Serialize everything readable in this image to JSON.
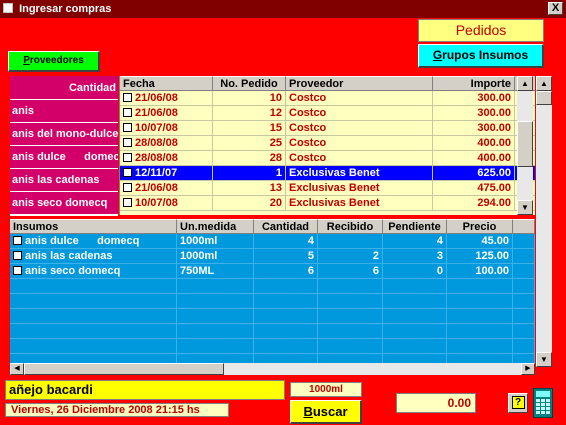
{
  "window": {
    "title": "Ingresar compras",
    "close_label": "X"
  },
  "buttons": {
    "pedidos": "Pedidos",
    "grupos_first": "G",
    "grupos_rest": "rupos Insumos",
    "proveedores_first": "P",
    "proveedores_rest": "roveedores",
    "buscar_first": "B",
    "buscar_rest": "uscar"
  },
  "left_list": {
    "header": "Cantidad",
    "items": [
      "anis",
      "anis del mono-dulce",
      "anis dulce      domec",
      "anis las cadenas",
      "anis seco domecq"
    ]
  },
  "orders": {
    "columns": [
      "Fecha",
      "No. Pedido",
      "Proveedor",
      "Importe"
    ],
    "rows": [
      {
        "fecha": "21/06/08",
        "pedido": "10",
        "proveedor": "Costco",
        "importe": "300.00"
      },
      {
        "fecha": "21/06/08",
        "pedido": "12",
        "proveedor": "Costco",
        "importe": "300.00"
      },
      {
        "fecha": "10/07/08",
        "pedido": "15",
        "proveedor": "Costco",
        "importe": "300.00"
      },
      {
        "fecha": "28/08/08",
        "pedido": "25",
        "proveedor": "Costco",
        "importe": "400.00"
      },
      {
        "fecha": "28/08/08",
        "pedido": "28",
        "proveedor": "Costco",
        "importe": "400.00"
      },
      {
        "fecha": "12/11/07",
        "pedido": "1",
        "proveedor": "Exclusivas Benet",
        "importe": "625.00"
      },
      {
        "fecha": "21/06/08",
        "pedido": "13",
        "proveedor": "Exclusivas Benet",
        "importe": "475.00"
      },
      {
        "fecha": "10/07/08",
        "pedido": "20",
        "proveedor": "Exclusivas Benet",
        "importe": "294.00"
      }
    ],
    "selected_index": 5
  },
  "details": {
    "columns": [
      "Insumos",
      "Un.medida",
      "Cantidad",
      "Recibido",
      "Pendiente",
      "Precio"
    ],
    "rows": [
      {
        "insumo": "anis dulce      domecq",
        "um": "1000ml",
        "cantidad": "4",
        "recibido": "",
        "pendiente": "4",
        "precio": "45.00"
      },
      {
        "insumo": "anis las cadenas",
        "um": "1000ml",
        "cantidad": "5",
        "recibido": "2",
        "pendiente": "3",
        "precio": "125.00"
      },
      {
        "insumo": "anis seco domecq",
        "um": "750ML",
        "cantidad": "6",
        "recibido": "6",
        "pendiente": "0",
        "precio": "100.00"
      }
    ]
  },
  "footer": {
    "product": "añejo bacardi",
    "datetime": "Viernes,  26  Diciembre  2008   21:15 hs",
    "unit": "1000ml",
    "total": "0.00",
    "help_label": "?"
  },
  "icons": {
    "close": "close-icon",
    "help": "help-icon",
    "calculator": "calculator-icon",
    "scroll_up": "arrow-up-icon",
    "scroll_down": "arrow-down-icon",
    "scroll_left": "arrow-left-icon",
    "scroll_right": "arrow-right-icon"
  },
  "colors": {
    "background": "#ff0000",
    "titlebar": "#800000",
    "left_list": "#d4006a",
    "orders_bg": "#ffffc0",
    "orders_text": "#c00000",
    "selection": "#0000ff",
    "details_bg": "#0099dd",
    "pedidos_btn": "#ffff80",
    "grupos_btn": "#00ffff",
    "proveedores_btn": "#00ff00",
    "buscar_btn": "#ffff00"
  }
}
